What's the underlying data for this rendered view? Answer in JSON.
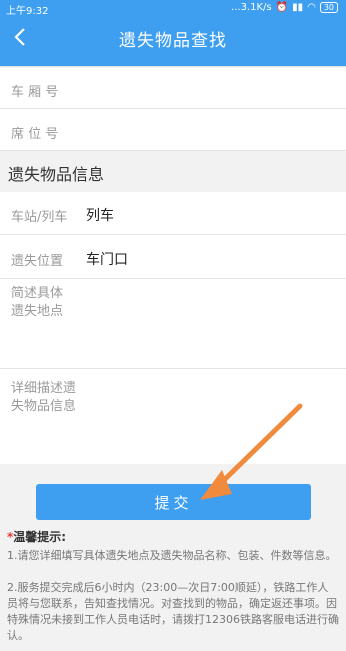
{
  "status": {
    "time": "上午9:32",
    "speed": "...3.1K/s",
    "battery": "30"
  },
  "header": {
    "title": "遗失物品查找"
  },
  "form": {
    "car_label": "车 厢 号",
    "seat_label": "席 位 号",
    "section_title": "遗失物品信息",
    "station_label": "车站/列车",
    "station_value": "列车",
    "location_label": "遗失位置",
    "location_value": "车门口",
    "brief_label_1": "简述具体",
    "brief_label_2": "遗失地点",
    "detail_label_1": "详细描述遗",
    "detail_label_2": "失物品信息"
  },
  "submit_label": "提交",
  "tips": {
    "star": "*",
    "title": "温馨提示:",
    "item1": "1.请您详细填写具体遗失地点及遗失物品名称、包装、件数等信息。",
    "item2": "2.服务提交完成后6小时内（23:00—次日7:00顺延），铁路工作人员将与您联系，告知查找情况。对查找到的物品，确定返还事项。因特殊情况未接到工作人员电话时，请拨打12306铁路客服电话进行确认。"
  },
  "colors": {
    "accent": "#3e9ff1",
    "arrow": "#f08a3c"
  }
}
